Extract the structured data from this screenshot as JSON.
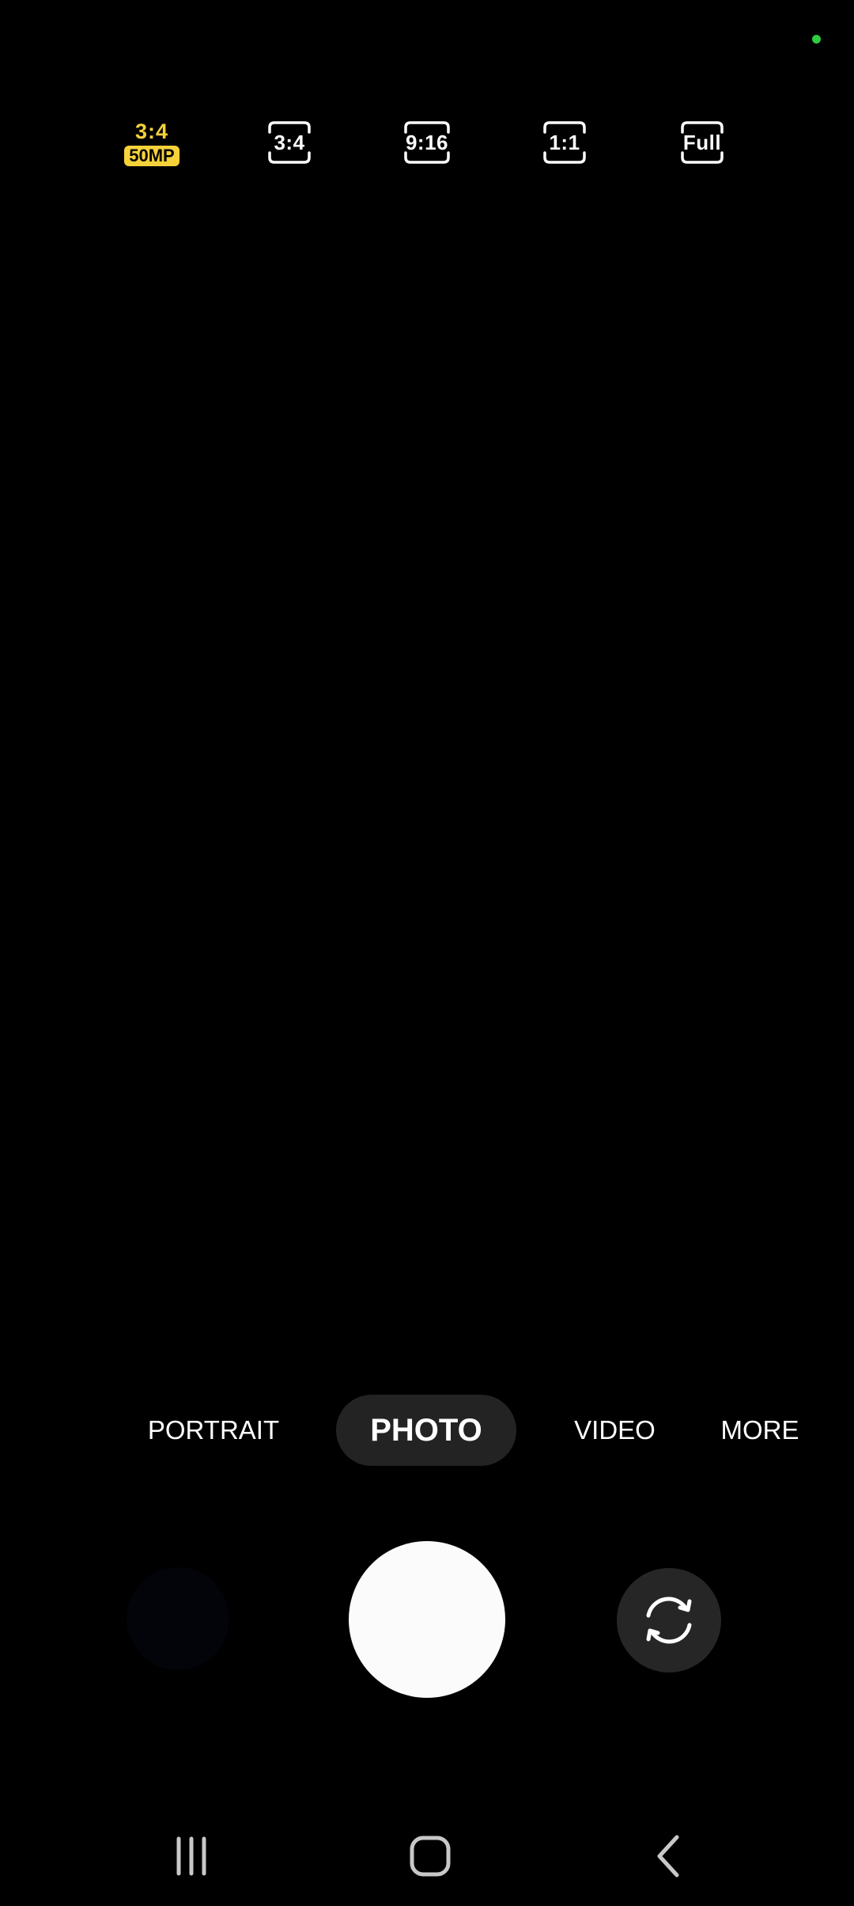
{
  "status": {
    "privacy_indicator_color": "#2ecc40"
  },
  "aspect_ratios": {
    "selected": {
      "ratio": "3:4",
      "badge": "50MP",
      "color": "#f6d23a"
    },
    "options": [
      {
        "label": "3:4",
        "icon": "aspect-frame-icon"
      },
      {
        "label": "9:16",
        "icon": "aspect-frame-icon"
      },
      {
        "label": "1:1",
        "icon": "aspect-frame-icon"
      },
      {
        "label": "Full",
        "icon": "aspect-frame-icon"
      }
    ]
  },
  "modes": {
    "items": [
      "PORTRAIT",
      "PHOTO",
      "VIDEO",
      "MORE"
    ],
    "active": "PHOTO",
    "active_bg": "#232323"
  },
  "controls": {
    "shutter_icon": "shutter-icon",
    "switch_camera_icon": "switch-camera-icon"
  },
  "navbar": {
    "recents_icon": "recents-icon",
    "home_icon": "home-icon",
    "back_icon": "back-icon"
  }
}
